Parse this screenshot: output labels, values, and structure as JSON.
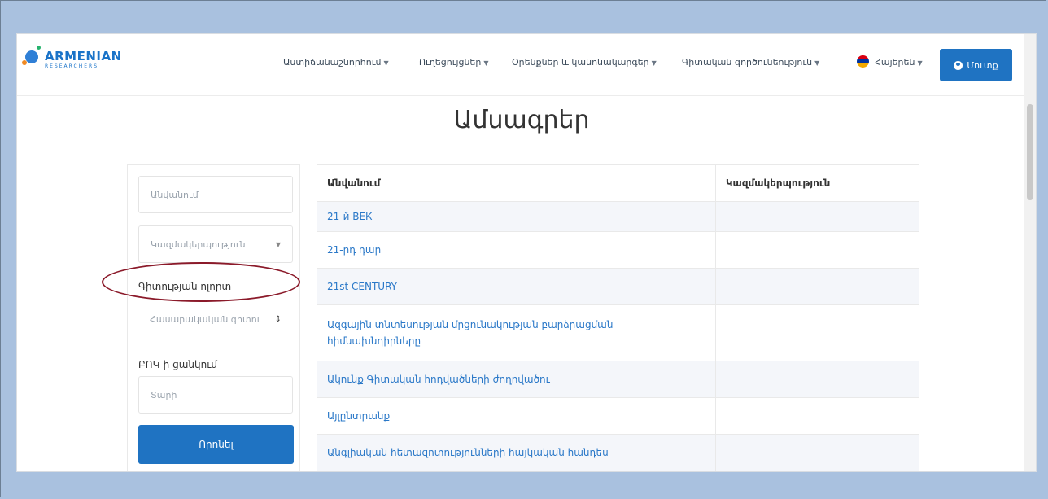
{
  "logo": {
    "name": "ARMENIAN",
    "sub": "RESEARCHERS"
  },
  "nav": {
    "items": [
      "Աստիճանաշնորհում",
      "Ուղեցույցներ",
      "Օրենքներ և կանոնակարգեր",
      "Գիտական գործունեություն"
    ],
    "language": "Հայերեն",
    "login": "Մուտք"
  },
  "page_title": "Ամսագրեր",
  "filters": {
    "name_placeholder": "Անվանում",
    "organization_placeholder": "Կազմակերպություն",
    "field_label": "Գիտության ոլորտ",
    "field_value": "Հասարակական գիտու",
    "bok_label": "ԲՈԿ-ի ցանկում",
    "bok_value": "Տարի",
    "search_button": "Որոնել"
  },
  "table": {
    "headers": [
      "Անվանում",
      "Կազմակերպություն"
    ],
    "rows": [
      "21-й ВЕК",
      "21-րդ դար",
      "21st CENTURY",
      "Ազգային տնտեսության մրցունակության բարձրացման հիմնախնդիրները",
      "Ակունք Գիտական հոդվածների ժողովածու",
      "Այլընտրանք",
      "Անգլիական հետազոտությունների հայկական հանդես"
    ]
  },
  "colors": {
    "accent": "#1f73c2",
    "annotation": "#8b1a2a"
  }
}
